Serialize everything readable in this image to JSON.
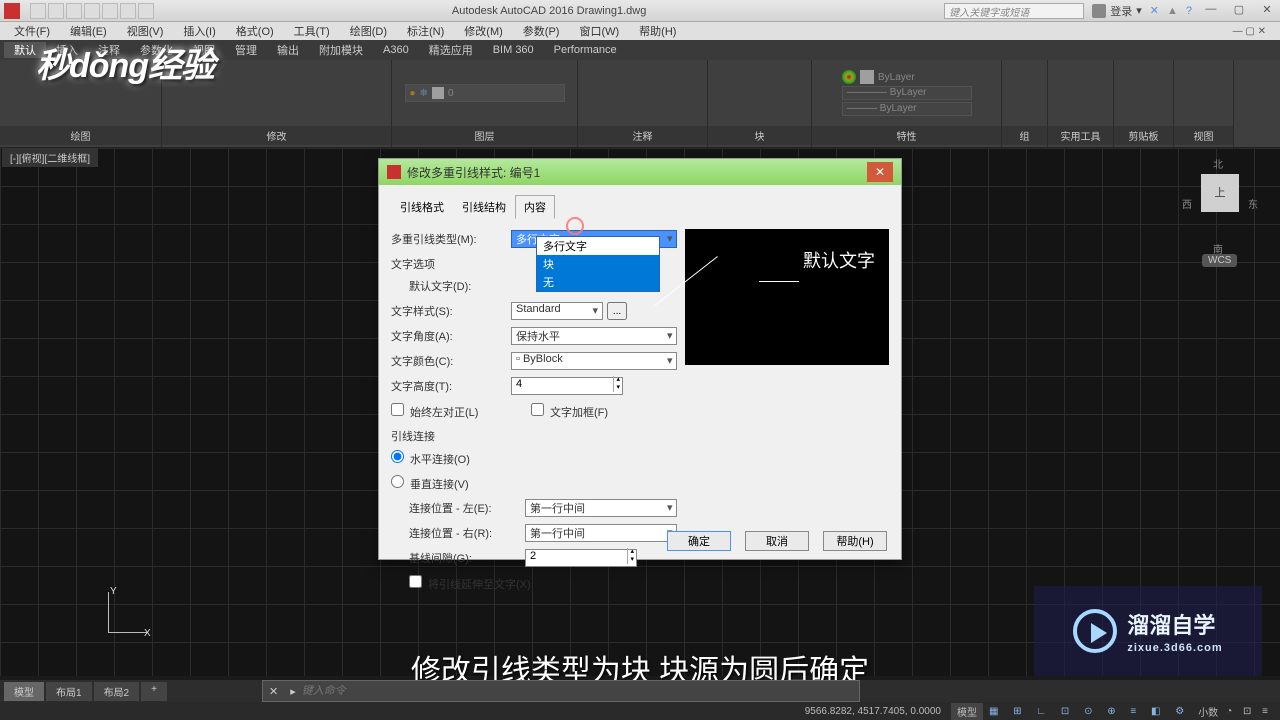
{
  "app": {
    "title": "Autodesk AutoCAD 2016   Drawing1.dwg",
    "search_ph": "键入关键字或短语",
    "login": "登录"
  },
  "menu": [
    "文件(F)",
    "编辑(E)",
    "视图(V)",
    "插入(I)",
    "格式(O)",
    "工具(T)",
    "绘图(D)",
    "标注(N)",
    "修改(M)",
    "参数(P)",
    "窗口(W)",
    "帮助(H)"
  ],
  "ribbon_tabs": [
    "默认",
    "插入",
    "注释",
    "参数化",
    "视图",
    "管理",
    "输出",
    "附加模块",
    "A360",
    "精选应用",
    "BIM 360",
    "Performance"
  ],
  "panels": [
    "绘图",
    "修改",
    "图层",
    "注释",
    "块",
    "特性",
    "组",
    "实用工具",
    "剪贴板",
    "视图"
  ],
  "layer": {
    "current": "0",
    "bylayer": "ByLayer"
  },
  "canvas": {
    "tab": "[-][俯视][二维线框]",
    "y": "Y",
    "x": "X"
  },
  "viewcube": {
    "n": "北",
    "s": "南",
    "w": "西",
    "e": "东",
    "top": "上",
    "wcs": "WCS"
  },
  "cmd": {
    "placeholder": "键入命令"
  },
  "status": {
    "tabs": [
      "模型",
      "布局1",
      "布局2"
    ],
    "coords": "9566.8282, 4517.7405, 0.0000",
    "scale": "小数",
    "mode": "模型"
  },
  "caption": "修改引线类型为块 块源为圆后确定",
  "brand": {
    "name": "溜溜自学",
    "url": "zixue.3d66.com"
  },
  "dialog": {
    "title": "修改多重引线样式: 编号1",
    "tabs": [
      "引线格式",
      "引线结构",
      "内容"
    ],
    "labels": {
      "type": "多重引线类型(M):",
      "type_val": "多行文字",
      "opt_group": "文字选项",
      "default": "默认文字(D):",
      "style": "文字样式(S):",
      "style_val": "Standard",
      "angle": "文字角度(A):",
      "angle_val": "保持水平",
      "color": "文字颜色(C):",
      "color_val": "ByBlock",
      "height": "文字高度(T):",
      "height_val": "4",
      "left_align": "始终左对正(L)",
      "frame": "文字加框(F)",
      "conn_group": "引线连接",
      "horiz": "水平连接(O)",
      "vert": "垂直连接(V)",
      "pos_left": "连接位置 - 左(E):",
      "pos_left_val": "第一行中间",
      "pos_right": "连接位置 - 右(R):",
      "pos_right_val": "第一行中间",
      "gap": "基线间隙(G):",
      "gap_val": "2",
      "extend": "将引线延伸至文字(X)"
    },
    "dd_options": [
      "多行文字",
      "块",
      "无"
    ],
    "preview_text": "默认文字",
    "ok": "确定",
    "cancel": "取消",
    "help": "帮助(H)"
  }
}
